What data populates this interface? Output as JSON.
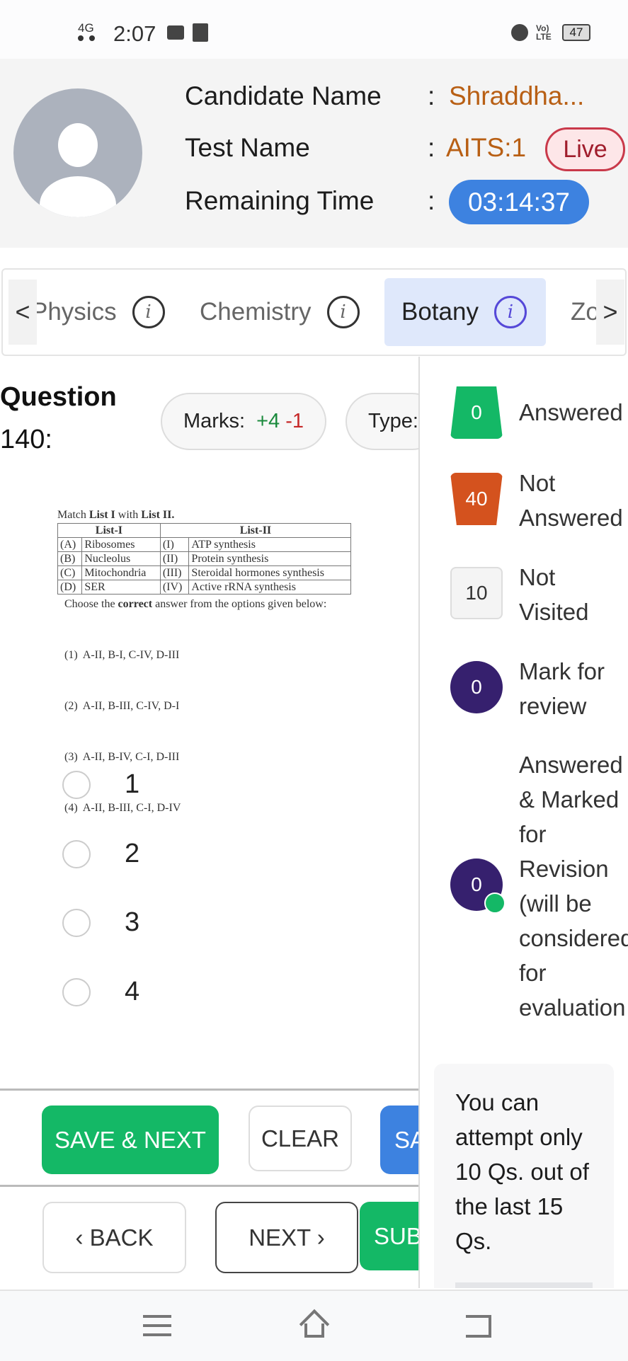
{
  "status_bar": {
    "network": "4G",
    "time": "2:07",
    "battery": "47",
    "volte": "VoLTE"
  },
  "header": {
    "candidate_label": "Candidate Name",
    "candidate_value": "Shraddha...",
    "test_label": "Test Name",
    "test_value": "AITS:1",
    "live_badge": "Live",
    "time_label": "Remaining Time",
    "time_value": "03:14:37",
    "separator": ":"
  },
  "tabs": {
    "prev": "<",
    "next": ">",
    "items": [
      {
        "label": "Physics",
        "active": false
      },
      {
        "label": "Chemistry",
        "active": false
      },
      {
        "label": "Botany",
        "active": true
      },
      {
        "label": "Zo",
        "active": false
      }
    ]
  },
  "question": {
    "title_line1": "Question",
    "title_line2": "140:",
    "marks_label": "Marks:",
    "marks_pos": "+4",
    "marks_neg": "-1",
    "type_label": "Type:",
    "prompt": {
      "pre": "Match ",
      "b1": "List I",
      "mid": " with ",
      "b2": "List II."
    },
    "table": {
      "head": [
        "List-I",
        "List-II"
      ],
      "rows": [
        [
          "(A)",
          "Ribosomes",
          "(I)",
          "ATP synthesis"
        ],
        [
          "(B)",
          "Nucleolus",
          "(II)",
          "Protein synthesis"
        ],
        [
          "(C)",
          "Mitochondria",
          "(III)",
          "Steroidal hormones synthesis"
        ],
        [
          "(D)",
          "SER",
          "(IV)",
          "Active rRNA synthesis"
        ]
      ]
    },
    "instruction": {
      "pre": "Choose the ",
      "bold": "correct",
      "post": " answer from the options given below:"
    },
    "choices": [
      "(1)  A-II, B-I, C-IV, D-III",
      "(2)  A-II, B-III, C-IV, D-I",
      "(3)  A-II, B-IV, C-I, D-III",
      "(4)  A-II, B-III, C-I, D-IV"
    ],
    "options": [
      "1",
      "2",
      "3",
      "4"
    ]
  },
  "buttons": {
    "save_next": "SAVE & NEXT",
    "clear": "CLEAR",
    "save_mark": "SA",
    "back": "BACK",
    "next": "NEXT",
    "submit": "SUB"
  },
  "legend": [
    {
      "count": "0",
      "label": "Answered",
      "color": "#14b866"
    },
    {
      "count": "40",
      "label": "Not Answered",
      "color": "#d4521e"
    },
    {
      "count": "10",
      "label": "Not Visited",
      "color": "#f4f4f4"
    },
    {
      "count": "0",
      "label": "Mark for review",
      "color": "#36206e"
    },
    {
      "count": "0",
      "label": "Answered & Marked for Revision (will be considered for evaluation",
      "color": "#36206e"
    }
  ],
  "note": "You can attempt only 10 Qs. out of the last 15 Qs.",
  "colors": {
    "green": "#14b866",
    "blue": "#3d82e0",
    "orange": "#b85f14",
    "red": "#c9394a"
  }
}
